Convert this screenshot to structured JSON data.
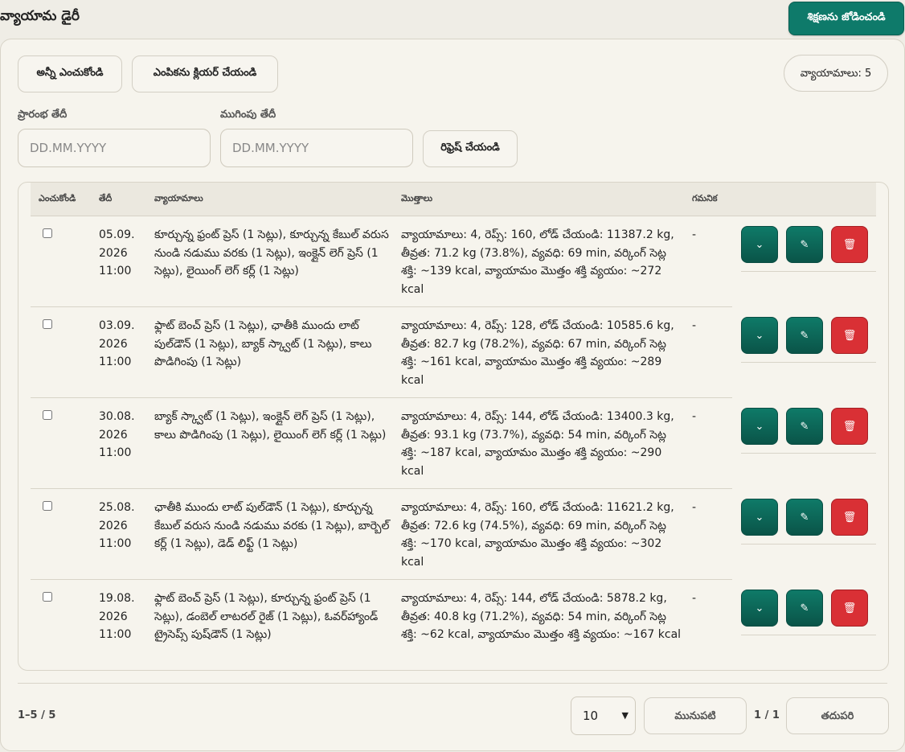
{
  "header": {
    "title": "వ్యాయామ డైరీ",
    "add_button": "శిక్షణను జోడించండి"
  },
  "toolbar": {
    "select_all": "అన్నీ ఎంచుకోండి",
    "clear_selection": "ఎంపికను క్లియర్ చేయండి",
    "count_label": "వ్యాయామాలు: 5"
  },
  "filters": {
    "start_label": "ప్రారంభ తేదీ",
    "end_label": "ముగింపు తేదీ",
    "start_placeholder": "DD.MM.YYYY",
    "end_placeholder": "DD.MM.YYYY",
    "refresh": "రిఫ్రెష్ చేయండి"
  },
  "table": {
    "columns": [
      "ఎంచుకోండి",
      "తేదీ",
      "వ్యాయామాలు",
      "మొత్తాలు",
      "గమనిక"
    ],
    "rows": [
      {
        "date": "05.09.\n2026\n11:00",
        "exercises": "కూర్చున్న ఫ్రంట్ ప్రెస్ (1 సెట్లు), కూర్చున్న కేబుల్ వరుస నుండి నడుము వరకు (1 సెట్లు), ఇంక్లైన్ లెగ్ ప్రెస్ (1 సెట్లు), లైయింగ్ లెగ్ కర్ల్ (1 సెట్లు)",
        "totals": "వ్యాయామాలు: 4, రెప్స్: 160, లోడ్ చేయండి: 11387.2 kg, తీవ్రత: 71.2 kg (73.8%), వ్యవధి: 69 min, వర్కింగ్ సెట్ల శక్తి: ~139 kcal, వ్యాయామం మొత్తం శక్తి వ్యయం: ~272 kcal",
        "note": "-"
      },
      {
        "date": "03.09.\n2026\n11:00",
        "exercises": "ఫ్లాట్ బెంచ్ ప్రెస్ (1 సెట్లు), ఛాతీకి ముందు లాట్ పుల్‌డౌన్ (1 సెట్లు), బ్యాక్ స్క్వాట్ (1 సెట్లు), కాలు పొడిగింపు (1 సెట్లు)",
        "totals": "వ్యాయామాలు: 4, రెప్స్: 128, లోడ్ చేయండి: 10585.6 kg, తీవ్రత: 82.7 kg (78.2%), వ్యవధి: 67 min, వర్కింగ్ సెట్ల శక్తి: ~161 kcal, వ్యాయామం మొత్తం శక్తి వ్యయం: ~289 kcal",
        "note": "-"
      },
      {
        "date": "30.08.\n2026\n11:00",
        "exercises": "బ్యాక్ స్క్వాట్ (1 సెట్లు), ఇంక్లైన్ లెగ్ ప్రెస్ (1 సెట్లు), కాలు పొడిగింపు (1 సెట్లు), లైయింగ్ లెగ్ కర్ల్ (1 సెట్లు)",
        "totals": "వ్యాయామాలు: 4, రెప్స్: 144, లోడ్ చేయండి: 13400.3 kg, తీవ్రత: 93.1 kg (73.7%), వ్యవధి: 54 min, వర్కింగ్ సెట్ల శక్తి: ~187 kcal, వ్యాయామం మొత్తం శక్తి వ్యయం: ~290 kcal",
        "note": "-"
      },
      {
        "date": "25.08.\n2026\n11:00",
        "exercises": "ఛాతీకి ముందు లాట్ పుల్‌డౌన్ (1 సెట్లు), కూర్చున్న కేబుల్ వరుస నుండి నడుము వరకు (1 సెట్లు), బార్బెల్ కర్ల్ (1 సెట్లు), డెడ్ లిఫ్ట్ (1 సెట్లు)",
        "totals": "వ్యాయామాలు: 4, రెప్స్: 160, లోడ్ చేయండి: 11621.2 kg, తీవ్రత: 72.6 kg (74.5%), వ్యవధి: 69 min, వర్కింగ్ సెట్ల శక్తి: ~170 kcal, వ్యాయామం మొత్తం శక్తి వ్యయం: ~302 kcal",
        "note": "-"
      },
      {
        "date": "19.08.\n2026\n11:00",
        "exercises": "ఫ్లాట్ బెంచ్ ప్రెస్ (1 సెట్లు), కూర్చున్న ఫ్రంట్ ప్రెస్ (1 సెట్లు), డంబెల్ లాటరల్ రైజ్ (1 సెట్లు), ఓవర్‌హ్యాండ్ ట్రైసెప్స్ పుష్‌డౌన్ (1 సెట్లు)",
        "totals": "వ్యాయామాలు: 4, రెప్స్: 144, లోడ్ చేయండి: 5878.2 kg, తీవ్రత: 40.8 kg (71.2%), వ్యవధి: 54 min, వర్కింగ్ సెట్ల శక్తి: ~62 kcal, వ్యాయామం మొత్తం శక్తి వ్యయం: ~167 kcal",
        "note": "-"
      }
    ],
    "icons": {
      "expand": "chevron-down-icon",
      "edit": "pencil-icon",
      "delete": "trash-icon"
    }
  },
  "pagination": {
    "range": "1–5 / 5",
    "page_size": "10",
    "prev": "మునుపటి",
    "page": "1 / 1",
    "next": "తదుపరి"
  },
  "colors": {
    "accent": "#0e7a6a",
    "danger": "#d93035",
    "background": "#efede6"
  }
}
